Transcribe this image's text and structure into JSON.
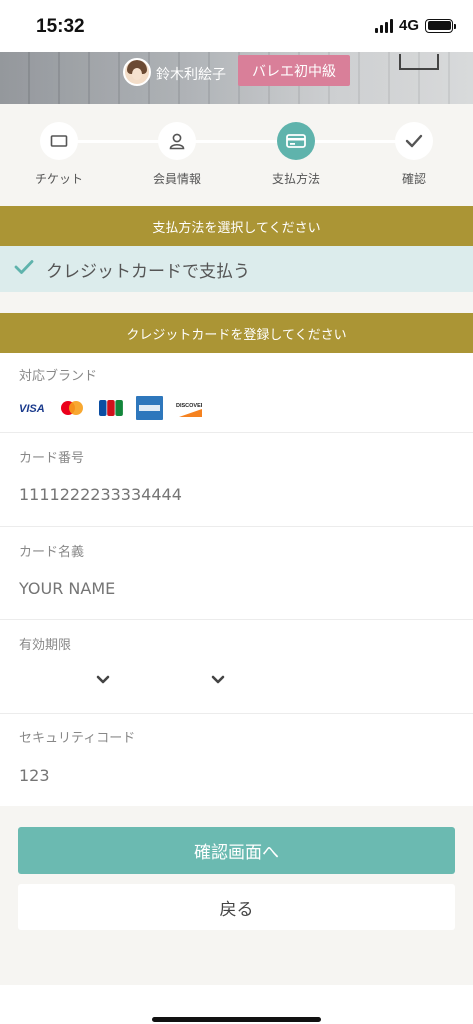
{
  "status_bar": {
    "time": "15:32",
    "network": "4G"
  },
  "header": {
    "teacher_name": "鈴木利絵子",
    "class_level": "バレエ初中級"
  },
  "stepper": {
    "steps": [
      {
        "label": "チケット",
        "icon": "ticket-icon",
        "active": false
      },
      {
        "label": "会員情報",
        "icon": "person-icon",
        "active": false
      },
      {
        "label": "支払方法",
        "icon": "credit-card-icon",
        "active": true
      },
      {
        "label": "確認",
        "icon": "checkmark-icon",
        "active": false
      }
    ]
  },
  "payment_section": {
    "title": "支払方法を選択してください",
    "selected_method": "クレジットカードで支払う"
  },
  "card_section": {
    "title": "クレジットカードを登録してください",
    "brands_label": "対応ブランド",
    "brands": [
      "VISA",
      "Mastercard",
      "JCB",
      "AMERICAN EXPRESS",
      "DISCOVER"
    ],
    "card_number": {
      "label": "カード番号",
      "placeholder": "1111222233334444"
    },
    "card_name": {
      "label": "カード名義",
      "placeholder": "YOUR NAME"
    },
    "expiry": {
      "label": "有効期限",
      "month": "",
      "year": ""
    },
    "security_code": {
      "label": "セキュリティコード",
      "placeholder": "123"
    }
  },
  "actions": {
    "confirm_label": "確認画面へ",
    "back_label": "戻る"
  },
  "colors": {
    "accent": "#5fb3ac",
    "gold": "#ab9535",
    "badge_pink": "#d97f99"
  }
}
